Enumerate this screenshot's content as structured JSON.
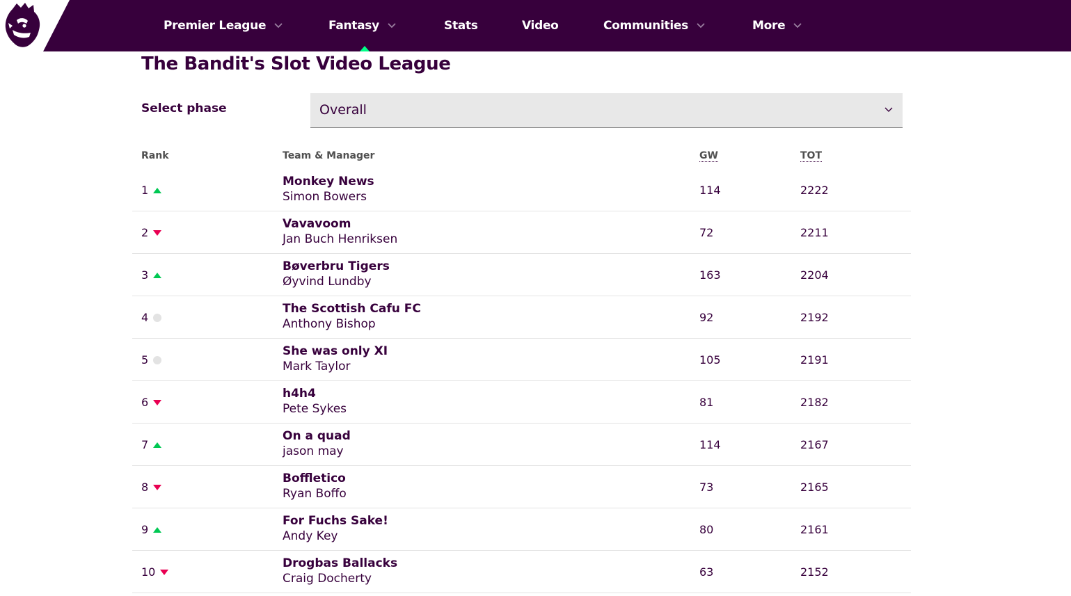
{
  "nav": {
    "items": [
      {
        "label": "Premier League",
        "has_dropdown": true
      },
      {
        "label": "Fantasy",
        "has_dropdown": true,
        "active": true
      },
      {
        "label": "Stats",
        "has_dropdown": false
      },
      {
        "label": "Video",
        "has_dropdown": false
      },
      {
        "label": "Communities",
        "has_dropdown": true
      },
      {
        "label": "More",
        "has_dropdown": true
      }
    ],
    "logo_icon": "premier-league-lion-icon"
  },
  "page": {
    "title": "The Bandit's Slot Video League"
  },
  "phase": {
    "label": "Select phase",
    "selected": "Overall"
  },
  "table": {
    "headers": {
      "rank": "Rank",
      "team": "Team & Manager",
      "gw": "GW",
      "tot": "TOT"
    },
    "rows": [
      {
        "rank": "1",
        "movement": "up",
        "team": "Monkey News",
        "manager": "Simon Bowers",
        "gw": "114",
        "tot": "2222"
      },
      {
        "rank": "2",
        "movement": "down",
        "team": "Vavavoom",
        "manager": "Jan Buch Henriksen",
        "gw": "72",
        "tot": "2211"
      },
      {
        "rank": "3",
        "movement": "up",
        "team": "Bøverbru Tigers",
        "manager": "Øyvind Lundby",
        "gw": "163",
        "tot": "2204"
      },
      {
        "rank": "4",
        "movement": "same",
        "team": "The Scottish Cafu FC",
        "manager": "Anthony Bishop",
        "gw": "92",
        "tot": "2192"
      },
      {
        "rank": "5",
        "movement": "same",
        "team": "She was only XI",
        "manager": "Mark Taylor",
        "gw": "105",
        "tot": "2191"
      },
      {
        "rank": "6",
        "movement": "down",
        "team": "h4h4",
        "manager": "Pete Sykes",
        "gw": "81",
        "tot": "2182"
      },
      {
        "rank": "7",
        "movement": "up",
        "team": "On a quad",
        "manager": "jason may",
        "gw": "114",
        "tot": "2167"
      },
      {
        "rank": "8",
        "movement": "down",
        "team": "Boffletico",
        "manager": "Ryan Boffo",
        "gw": "73",
        "tot": "2165"
      },
      {
        "rank": "9",
        "movement": "up",
        "team": "For Fuchs Sake!",
        "manager": "Andy Key",
        "gw": "80",
        "tot": "2161"
      },
      {
        "rank": "10",
        "movement": "down",
        "team": "Drogbas Ballacks",
        "manager": "Craig Docherty",
        "gw": "63",
        "tot": "2152"
      }
    ]
  },
  "colors": {
    "brand": "#37003c",
    "accent": "#00ff87",
    "up": "#00c853",
    "down": "#e90052",
    "same": "#e3e3e3"
  }
}
